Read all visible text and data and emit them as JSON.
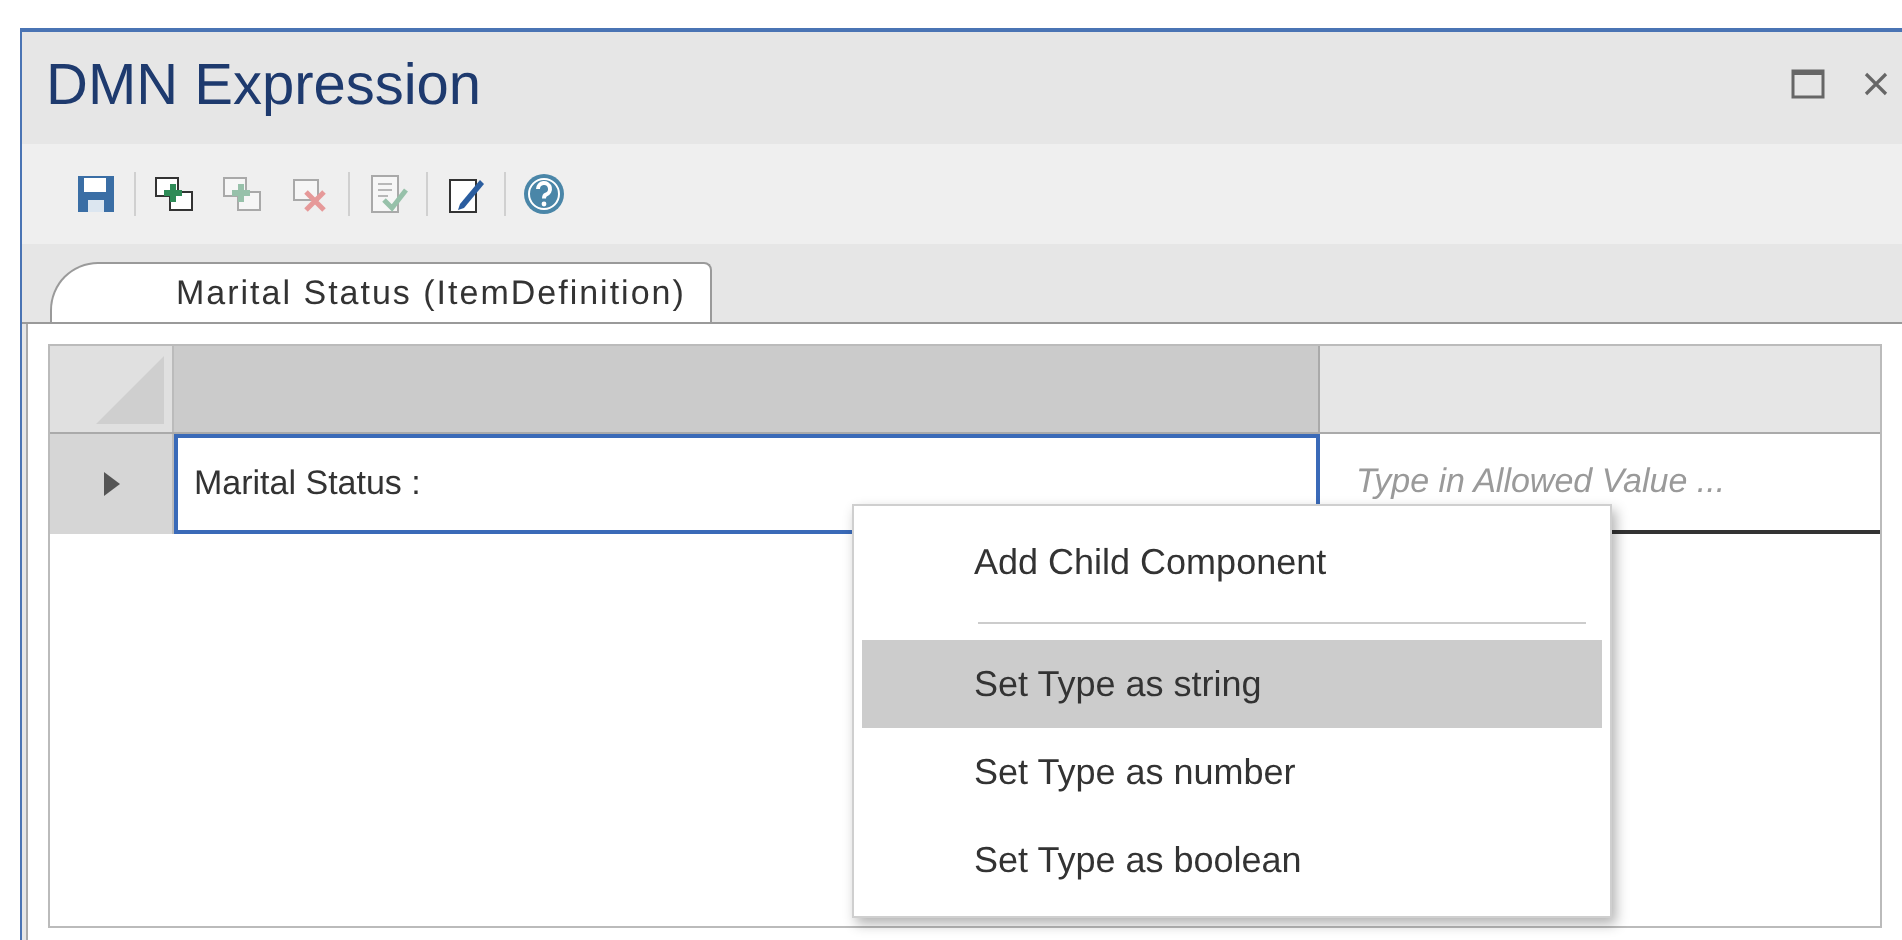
{
  "window": {
    "title": "DMN Expression"
  },
  "toolbar": [
    {
      "kind": "save",
      "disabled": false
    },
    {
      "kind": "add-child",
      "disabled": false
    },
    {
      "kind": "add-sibling",
      "disabled": true
    },
    {
      "kind": "delete",
      "disabled": true
    },
    {
      "kind": "validate",
      "disabled": true
    },
    {
      "kind": "edit",
      "disabled": false
    },
    {
      "kind": "help",
      "disabled": false
    }
  ],
  "tabs": [
    {
      "label": "Marital Status (ItemDefinition)",
      "selected": true
    }
  ],
  "grid": {
    "rows": [
      {
        "name": "Marital Status :",
        "placeholder": "Type in Allowed Value ...",
        "selected": true
      }
    ]
  },
  "context_menu": {
    "items": [
      {
        "kind": "item",
        "label": "Add Child Component",
        "selected": false
      },
      {
        "kind": "separator"
      },
      {
        "kind": "item",
        "label": "Set Type as string",
        "selected": true
      },
      {
        "kind": "item",
        "label": "Set Type as number",
        "selected": false
      },
      {
        "kind": "item",
        "label": "Set Type as boolean",
        "selected": false
      }
    ]
  }
}
